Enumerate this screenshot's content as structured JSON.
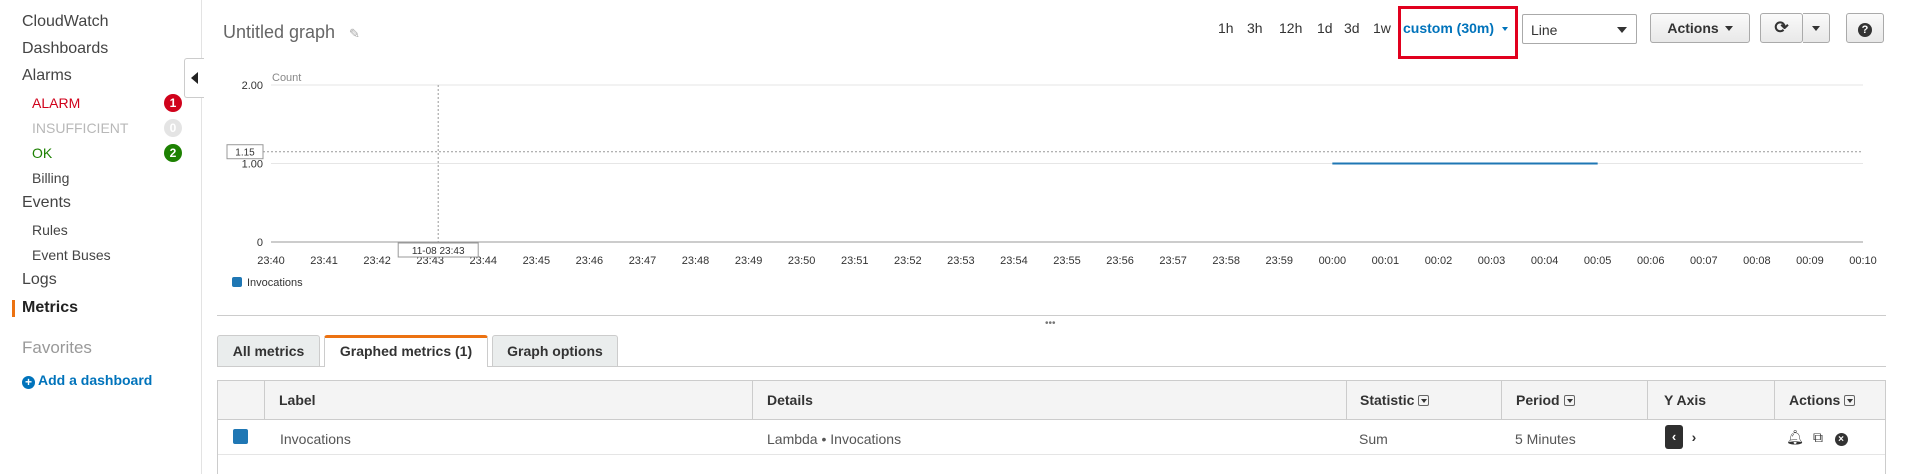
{
  "sidebar": {
    "cloudwatch": "CloudWatch",
    "dashboards": "Dashboards",
    "alarms": "Alarms",
    "alarm": {
      "label": "ALARM",
      "count": "1"
    },
    "insufficient": {
      "label": "INSUFFICIENT",
      "count": "0"
    },
    "ok": {
      "label": "OK",
      "count": "2"
    },
    "billing": "Billing",
    "events": "Events",
    "rules": "Rules",
    "event_buses": "Event Buses",
    "logs": "Logs",
    "metrics": "Metrics",
    "favorites": "Favorites",
    "add_dashboard": "Add a dashboard"
  },
  "header": {
    "title": "Untitled graph",
    "ranges": [
      "1h",
      "3h",
      "12h",
      "1d",
      "3d",
      "1w"
    ],
    "custom_range": "custom (30m)",
    "view_type": "Line",
    "actions_label": "Actions"
  },
  "chart_data": {
    "type": "line",
    "title": "",
    "ylabel": "Count",
    "xlabel": "",
    "ylim": [
      0,
      2
    ],
    "yticks": [
      "0",
      "1.00",
      "2.00"
    ],
    "x_ticks": [
      "23:40",
      "23:41",
      "23:42",
      "23:43",
      "23:44",
      "23:45",
      "23:46",
      "23:47",
      "23:48",
      "23:49",
      "23:50",
      "23:51",
      "23:52",
      "23:53",
      "23:54",
      "23:55",
      "23:56",
      "23:57",
      "23:58",
      "23:59",
      "00:00",
      "00:01",
      "00:02",
      "00:03",
      "00:04",
      "00:05",
      "00:06",
      "00:07",
      "00:08",
      "00:09",
      "00:10"
    ],
    "series": [
      {
        "name": "Invocations",
        "color": "#1f77b4",
        "x": [
          "00:00",
          "00:05"
        ],
        "values": [
          1,
          1
        ]
      }
    ],
    "crosshair": {
      "x_label": "11-08 23:43",
      "y_label": "1.15",
      "x": "23:43",
      "y": 1.15
    },
    "grid": true,
    "legend": "bottom-left"
  },
  "tabs": [
    {
      "label": "All metrics"
    },
    {
      "label": "Graphed metrics (1)"
    },
    {
      "label": "Graph options"
    }
  ],
  "table": {
    "columns": [
      "Label",
      "Details",
      "Statistic",
      "Period",
      "Y Axis",
      "Actions"
    ],
    "rows": [
      {
        "label": "Invocations",
        "details": "Lambda • Invocations",
        "statistic": "Sum",
        "period": "5 Minutes"
      }
    ]
  }
}
